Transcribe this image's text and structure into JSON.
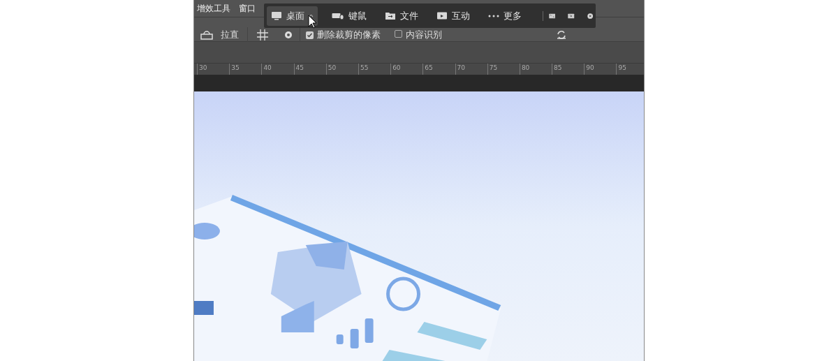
{
  "menu_bar": {
    "items": [
      "增效工具",
      "窗口"
    ]
  },
  "remote_toolbar": {
    "items": [
      {
        "kind": "desktop",
        "label": "桌面",
        "selected": true
      },
      {
        "kind": "keyboard",
        "label": "键鼠",
        "selected": false
      },
      {
        "kind": "file",
        "label": "文件",
        "selected": false
      },
      {
        "kind": "interact",
        "label": "互动",
        "selected": false
      },
      {
        "kind": "more",
        "label": "更多",
        "selected": false
      }
    ]
  },
  "options_bar": {
    "straighten": "拉直",
    "delete_cropped": {
      "label": "删除裁剪的像素",
      "checked": true
    },
    "content_aware": {
      "label": "内容识别",
      "checked": false
    }
  },
  "ruler": {
    "labels": [
      "30",
      "35",
      "40",
      "45",
      "50",
      "55",
      "60",
      "65",
      "70",
      "75",
      "80",
      "85",
      "90",
      "95"
    ]
  }
}
